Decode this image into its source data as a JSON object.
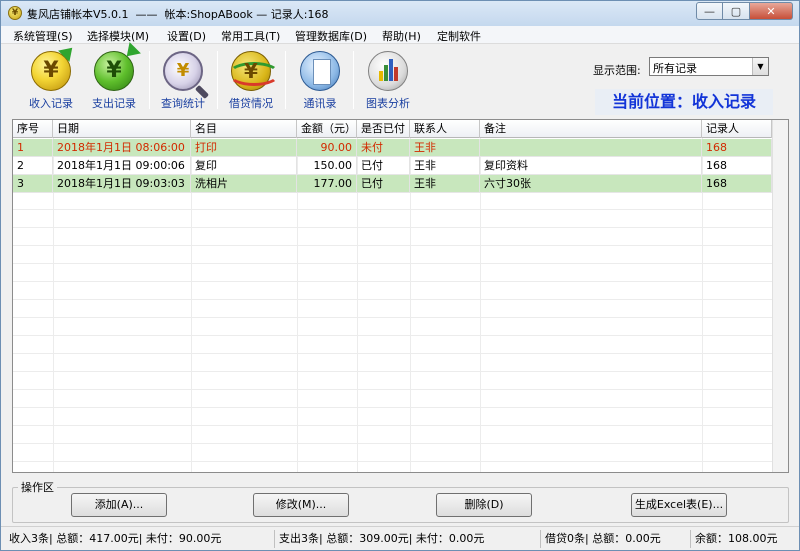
{
  "window": {
    "title": "隻风店铺帐本V5.0.1  ——  帐本:ShopABook — 记录人:168",
    "buttons": [
      "—",
      "▢",
      "✕"
    ]
  },
  "menu": [
    "系统管理(S)",
    "选择模块(M)",
    "设置(D)",
    "常用工具(T)",
    "管理数据库(D)",
    "帮助(H)",
    "定制软件"
  ],
  "toolbar": {
    "tools": [
      "收入记录",
      "支出记录",
      "查询统计",
      "借贷情况",
      "通讯录",
      "图表分析"
    ],
    "range_label": "显示范围:",
    "range_value": "所有记录",
    "location": "当前位置：收入记录"
  },
  "table": {
    "headers": [
      "序号",
      "日期",
      "名目",
      "金额（元）",
      "是否已付",
      "联系人",
      "备注",
      "记录人"
    ],
    "rows": [
      [
        "1",
        "2018年1月1日 08:06:00",
        "打印",
        "90.00",
        "未付",
        "王非",
        "",
        "168"
      ],
      [
        "2",
        "2018年1月1日 09:00:06",
        "复印",
        "150.00",
        "已付",
        "王非",
        "复印资料",
        "168"
      ],
      [
        "3",
        "2018年1月1日 09:03:03",
        "洗相片",
        "177.00",
        "已付",
        "王非",
        "六寸30张",
        "168"
      ]
    ]
  },
  "ops": {
    "label": "操作区",
    "add": "添加(A)...",
    "edit": "修改(M)...",
    "delete": "删除(D)",
    "excel": "生成Excel表(E)..."
  },
  "status": {
    "income": "收入3条| 总额：417.00元| 未付：90.00元",
    "expense": "支出3条| 总额：309.00元| 未付：0.00元",
    "loan": "借贷0条| 总额：0.00元",
    "balance": "余额：108.00元"
  },
  "colors": {
    "selected_row_text": "#d22a00",
    "row_highlight": "#c8e7bd",
    "location_text": "#1234d8",
    "toolbar_label": "#1a3fa0"
  }
}
